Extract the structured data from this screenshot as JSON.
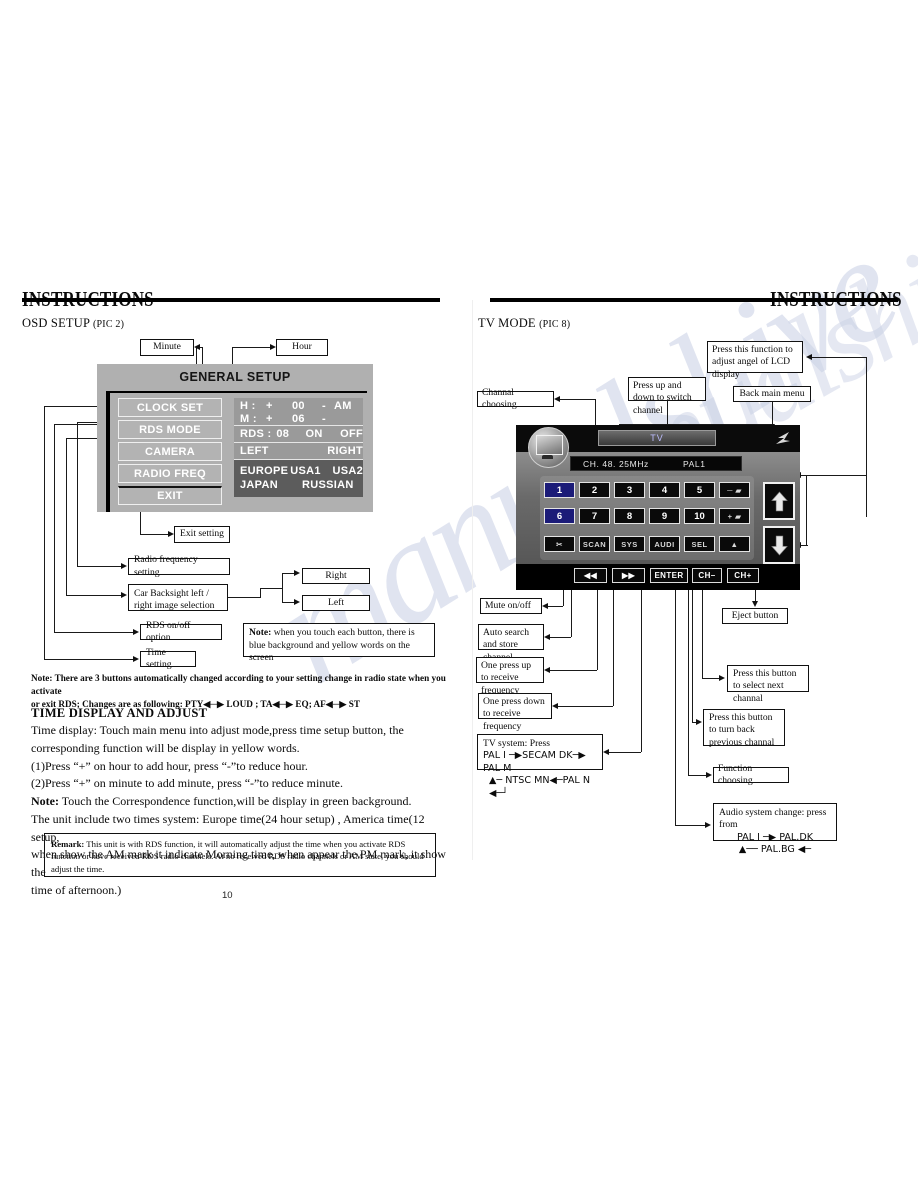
{
  "meta": {
    "page_number": "10",
    "watermark": "manualshive"
  },
  "left_page": {
    "header": "INSTRUCTIONS",
    "section_title": "OSD SETUP",
    "section_tag": "(PIC 2)",
    "callouts": {
      "minute": "Minute",
      "hour": "Hour",
      "exit_setting": "Exit setting",
      "radio_frequency_setting": "Radio frequency setting",
      "car_backsight": "Car Backsight left / right image selection",
      "rds_option": "RDS on/off option",
      "time_setting": "Time setting",
      "right": "Right",
      "left": "Left",
      "note_touch_label": "Note:",
      "note_touch_text": " when you touch each button, there is blue background and yellow words on the screen"
    },
    "osd": {
      "title": "GENERAL SETUP",
      "menu_buttons": [
        "CLOCK SET",
        "RDS MODE",
        "CAMERA",
        "RADIO FREQ",
        "EXIT"
      ],
      "hour_row": {
        "label": "H :",
        "plus": "+",
        "value": "00",
        "minus": "-",
        "ampm": "AM"
      },
      "minute_row": {
        "label": "M :",
        "plus": "+",
        "value": "06",
        "minus": "-",
        "ampm": ""
      },
      "rds_row": {
        "label": "RDS :",
        "value": "08",
        "on": "ON",
        "off": "OFF"
      },
      "camera_row": {
        "left": "LEFT",
        "right": "RIGHT"
      },
      "region_row_1": [
        "EUROPE",
        "USA1",
        "USA2"
      ],
      "region_row_2": [
        "JAPAN",
        "RUSSIAN"
      ]
    },
    "note_block": {
      "label": "Note:",
      "line1": " There are 3 buttons automatically changed according to your setting change in radio state when you activate",
      "line2": "or exit RDS; Changes are as following: PTY◀─▶ LOUD ; TA◀─▶ EQ; AF◀─▶ ST"
    },
    "time_section": {
      "heading": "TIME DISPLAY AND ADJUST",
      "line1": "Time display: Touch main menu into adjust mode,press time setup button, the",
      "line2": "corresponding function will be display in yellow words.",
      "line3": "(1)Press “+” on hour to add hour, press “-”to reduce hour.",
      "line4": "(2)Press “+” on minute to add minute, press “-”to  reduce minute.",
      "line5_bold": "Note:",
      "line5": " Touch the Correspondence function,will be display in green background.",
      "line6": "The unit include two times system: Europe time(24 hour setup) , America time(12 setup,",
      "line7": "when show the AM mark it indicate Morning time, when appear the PM mark, it show the",
      "line8": "time of afternoon.)"
    },
    "remark": {
      "label": "Remark:",
      "text": " This unit is with RDS function, it will automatically adjust the time when you activate RDS function or have received RDS radio channels. At no received RDS radio channels or AM state, you should adjust the time."
    }
  },
  "right_page": {
    "header": "INSTRUCTIONS",
    "section_title": "TV MODE",
    "section_tag": "(PIC 8)",
    "callouts": {
      "channel_choosing": "Channal choosing",
      "press_up_down": "Press up and down to switch channel",
      "adjust_angle": "Press this function to adjust angel of LCD display",
      "back_main_menu": "Back main menu",
      "mute": "Mute on/off",
      "auto_search": "Auto search and store channel",
      "one_press_up": "One press up to receive frequency",
      "one_press_down": "One press down to receive frequency",
      "eject_button": "Eject button",
      "select_next": "Press this button to select next channal",
      "turn_back_prev": "Press this button to turn back previous channal",
      "function_choosing": "Function choosing",
      "tv_system_title": "TV system: Press",
      "tv_system_l1": "PAL I ─▶SECAM DK─▶ PAL M",
      "tv_system_l2": "▲─ NTSC MN◀─PAL N ◀─┘",
      "audio_title": "Audio system change: press from",
      "audio_l1": "PAL I      ─▶     PAL.DK",
      "audio_l2": "▲──  PAL.BG  ◀─"
    },
    "tv": {
      "title": "TV",
      "info_left": "CH.  48.  25MHz",
      "info_right": "PAL1",
      "keys_row1": [
        "1",
        "2",
        "3",
        "4",
        "5",
        "─ ▰"
      ],
      "keys_row2": [
        "6",
        "7",
        "8",
        "9",
        "10",
        "+ ▰"
      ],
      "keys_row3": [
        "✂",
        "SCAN",
        "SYS",
        "AUDI",
        "SEL",
        "▲"
      ],
      "bottom_buttons": [
        "◀◀",
        "▶▶",
        "ENTER",
        "CH–",
        "CH+"
      ],
      "selected_keys": [
        "1",
        "6"
      ],
      "arrow_up": "⬆",
      "arrow_down": "⬇"
    }
  }
}
